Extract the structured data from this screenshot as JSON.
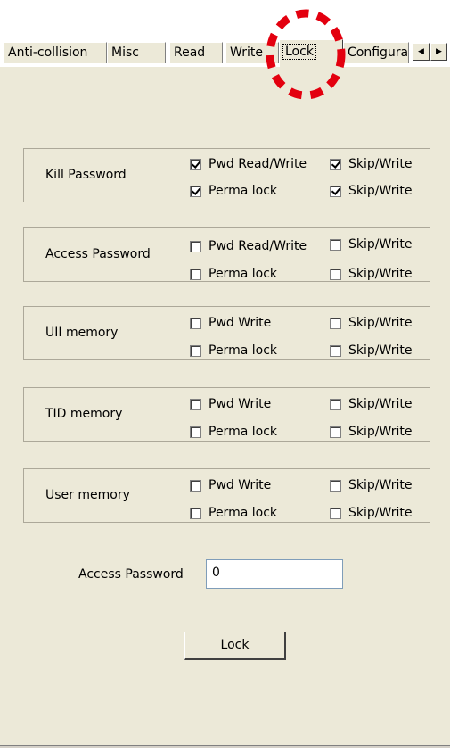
{
  "tabs": [
    {
      "label": "Anti-collision"
    },
    {
      "label": "Misc"
    },
    {
      "label": "Read"
    },
    {
      "label": "Write"
    },
    {
      "label": "Lock"
    },
    {
      "label": "Configuration"
    }
  ],
  "active_tab": "Lock",
  "scroll_left_glyph": "◀",
  "scroll_right_glyph": "▶",
  "groups": [
    {
      "label": "Kill Password",
      "row1": {
        "left": {
          "text": "Pwd Read/Write",
          "checked": true
        },
        "right": {
          "text": "Skip/Write",
          "checked": true
        }
      },
      "row2": {
        "left": {
          "text": "Perma lock",
          "checked": true
        },
        "right": {
          "text": "Skip/Write",
          "checked": true
        }
      }
    },
    {
      "label": "Access Password",
      "row1": {
        "left": {
          "text": "Pwd Read/Write",
          "checked": false
        },
        "right": {
          "text": "Skip/Write",
          "checked": false
        }
      },
      "row2": {
        "left": {
          "text": "Perma lock",
          "checked": false
        },
        "right": {
          "text": "Skip/Write",
          "checked": false
        }
      }
    },
    {
      "label": "UII memory",
      "row1": {
        "left": {
          "text": "Pwd Write",
          "checked": false
        },
        "right": {
          "text": "Skip/Write",
          "checked": false
        }
      },
      "row2": {
        "left": {
          "text": "Perma lock",
          "checked": false
        },
        "right": {
          "text": "Skip/Write",
          "checked": false
        }
      }
    },
    {
      "label": "TID memory",
      "row1": {
        "left": {
          "text": "Pwd Write",
          "checked": false
        },
        "right": {
          "text": "Skip/Write",
          "checked": false
        }
      },
      "row2": {
        "left": {
          "text": "Perma lock",
          "checked": false
        },
        "right": {
          "text": "Skip/Write",
          "checked": false
        }
      }
    },
    {
      "label": "User memory",
      "row1": {
        "left": {
          "text": "Pwd Write",
          "checked": false
        },
        "right": {
          "text": "Skip/Write",
          "checked": false
        }
      },
      "row2": {
        "left": {
          "text": "Perma lock",
          "checked": false
        },
        "right": {
          "text": "Skip/Write",
          "checked": false
        }
      }
    }
  ],
  "access_password": {
    "label": "Access Password",
    "value": "0"
  },
  "lock_button": {
    "label": "Lock"
  },
  "colors": {
    "panel": "#ece9d8",
    "highlight": "#e3000f",
    "group_border": "#aca899"
  }
}
